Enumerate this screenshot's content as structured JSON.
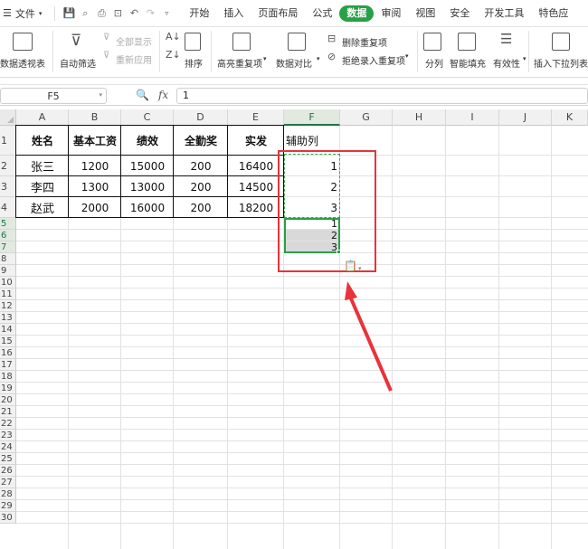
{
  "menubar": {
    "file_label": "文件",
    "tabs": [
      "开始",
      "插入",
      "页面布局",
      "公式",
      "数据",
      "审阅",
      "视图",
      "安全",
      "开发工具",
      "特色应"
    ],
    "active_tab": "数据"
  },
  "ribbon": {
    "pivot": "数据透视表",
    "autofilter": "自动筛选",
    "show_all": "全部显示",
    "reapply": "重新应用",
    "sort": "排序",
    "highlight_dup": "高亮重复项",
    "compare": "数据对比",
    "remove_dup": "删除重复项",
    "reject_dup": "拒绝录入重复项",
    "split": "分列",
    "smart_fill": "智能填充",
    "validity": "有效性",
    "dropdown_list": "插入下拉列表"
  },
  "formula_bar": {
    "name_box": "F5",
    "fx": "fx",
    "content": "1"
  },
  "sheet": {
    "columns": [
      "A",
      "B",
      "C",
      "D",
      "E",
      "F",
      "G",
      "H",
      "I",
      "J",
      "K"
    ],
    "rows": [
      "1",
      "2",
      "3",
      "4",
      "5",
      "6",
      "7",
      "8",
      "9",
      "10",
      "11",
      "12",
      "13",
      "14",
      "15",
      "16",
      "17",
      "18",
      "19",
      "20",
      "21",
      "22",
      "23",
      "24",
      "25",
      "26",
      "27",
      "28",
      "29",
      "30"
    ],
    "headers": [
      "姓名",
      "基本工资",
      "绩效",
      "全勤奖",
      "实发",
      "辅助列"
    ],
    "data": [
      [
        "张三",
        "1200",
        "15000",
        "200",
        "16400",
        "1"
      ],
      [
        "李四",
        "1300",
        "13000",
        "200",
        "14500",
        "2"
      ],
      [
        "赵武",
        "2000",
        "16000",
        "200",
        "18200",
        "3"
      ]
    ],
    "pasted": [
      "1",
      "2",
      "3"
    ]
  }
}
